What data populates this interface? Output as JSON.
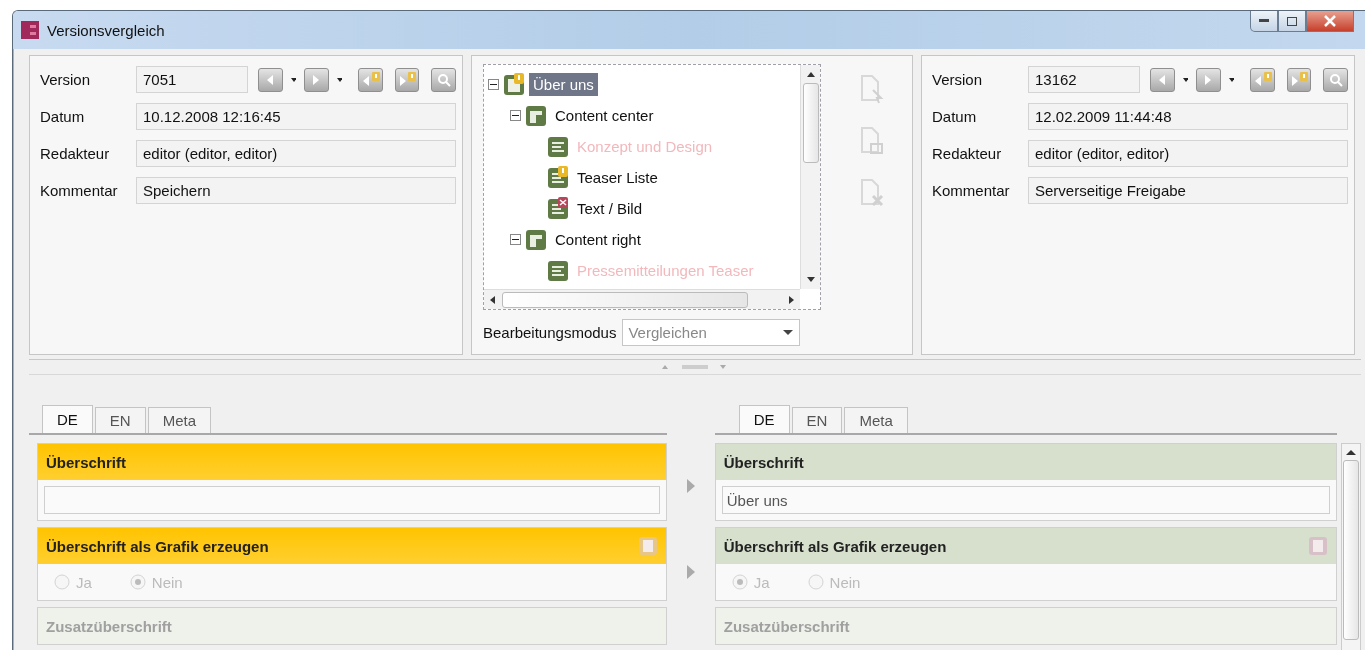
{
  "window": {
    "title": "Versionsvergleich"
  },
  "left_version": {
    "fields": [
      {
        "label": "Version",
        "value": "7051",
        "kind": "version"
      },
      {
        "label": "Datum",
        "value": "10.12.2008 12:16:45",
        "kind": "text"
      },
      {
        "label": "Redakteur",
        "value": "editor (editor, editor)",
        "kind": "text"
      },
      {
        "label": "Kommentar",
        "value": "Speichern",
        "kind": "text"
      }
    ]
  },
  "tree": {
    "items": [
      {
        "label": "Über uns",
        "kind": "page-warning",
        "selected": true,
        "removed": false,
        "expanded": true,
        "children": [
          {
            "label": "Content center",
            "kind": "section",
            "selected": false,
            "removed": false,
            "expanded": true,
            "children": [
              {
                "label": "Konzept und Design",
                "kind": "paragraph",
                "selected": false,
                "removed": true
              },
              {
                "label": "Teaser Liste",
                "kind": "paragraph-warning",
                "selected": false,
                "removed": false
              },
              {
                "label": "Text / Bild",
                "kind": "paragraph-error",
                "selected": false,
                "removed": false
              }
            ]
          },
          {
            "label": "Content right",
            "kind": "section",
            "selected": false,
            "removed": false,
            "expanded": true,
            "children": [
              {
                "label": "Pressemitteilungen Teaser",
                "kind": "paragraph",
                "selected": false,
                "removed": true
              }
            ]
          }
        ]
      }
    ]
  },
  "mode": {
    "label": "Bearbeitungsmodus",
    "value": "Vergleichen"
  },
  "right_version": {
    "fields": [
      {
        "label": "Version",
        "value": "13162",
        "kind": "version"
      },
      {
        "label": "Datum",
        "value": "12.02.2009 11:44:48",
        "kind": "text"
      },
      {
        "label": "Redakteur",
        "value": "editor (editor, editor)",
        "kind": "text"
      },
      {
        "label": "Kommentar",
        "value": "Serverseitige Freigabe",
        "kind": "text"
      }
    ]
  },
  "left_form": {
    "tabs": [
      {
        "label": "DE",
        "selected": true
      },
      {
        "label": "EN",
        "selected": false
      },
      {
        "label": "Meta",
        "selected": false
      }
    ],
    "sections": [
      {
        "title": "Überschrift",
        "kind": "text",
        "changed": true,
        "disabled": false
      },
      {
        "title": "Überschrift als Grafik erzeugen",
        "kind": "radio",
        "changed": true,
        "disabled": false,
        "options": [
          {
            "label": "Ja",
            "selected": false
          },
          {
            "label": "Nein",
            "selected": true
          }
        ]
      },
      {
        "title": "Zusatzüberschrift",
        "kind": "collapsed",
        "changed": false,
        "disabled": true
      }
    ]
  },
  "right_form": {
    "tabs": [
      {
        "label": "DE",
        "selected": true
      },
      {
        "label": "EN",
        "selected": false
      },
      {
        "label": "Meta",
        "selected": false
      }
    ],
    "sections": [
      {
        "title": "Überschrift",
        "kind": "text",
        "changed": false,
        "disabled": false,
        "value": "Über uns"
      },
      {
        "title": "Überschrift als Grafik erzeugen",
        "kind": "radio",
        "changed": false,
        "disabled": false,
        "options": [
          {
            "label": "Ja",
            "selected": true
          },
          {
            "label": "Nein",
            "selected": false
          }
        ]
      },
      {
        "title": "Zusatzüberschrift",
        "kind": "collapsed",
        "changed": false,
        "disabled": true
      }
    ]
  }
}
